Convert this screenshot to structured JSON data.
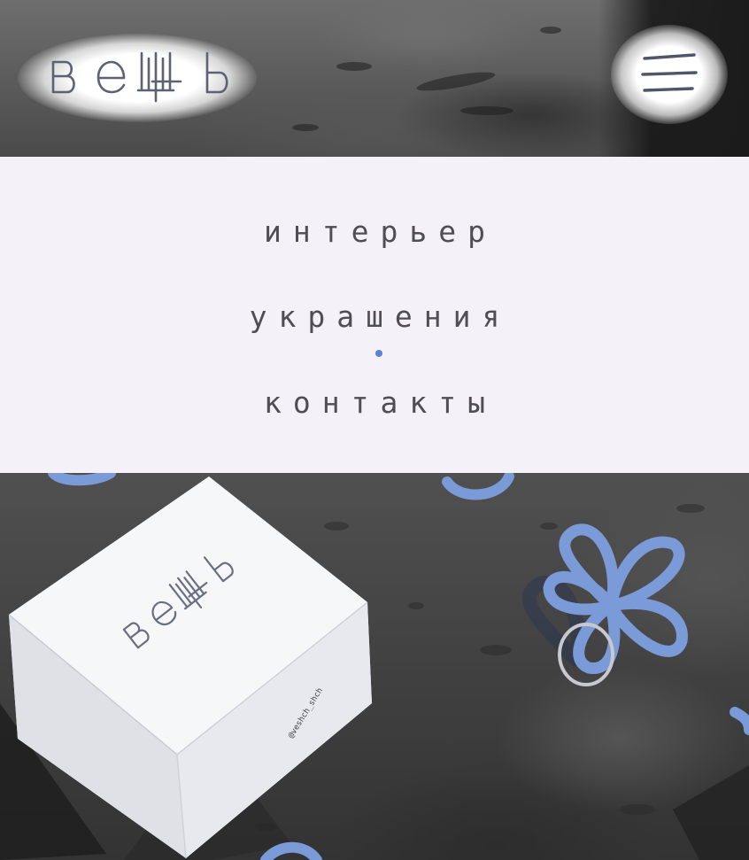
{
  "brand": {
    "logo_text": "вешь",
    "logo_icon": "veshch-wordmark"
  },
  "header": {
    "menu_icon": "hamburger-menu-icon"
  },
  "nav": {
    "items": [
      {
        "label": "интерьер"
      },
      {
        "label": "украшения",
        "active": true
      },
      {
        "label": "контакты"
      }
    ]
  },
  "hero": {
    "box_logo_text": "вешь",
    "box_side_text": "@veshch_shch"
  },
  "colors": {
    "accent": "#5a82d8",
    "nav_background": "#f4f2f8",
    "nav_text": "#4e4e54",
    "flower_blue": "#7a9ad8"
  }
}
